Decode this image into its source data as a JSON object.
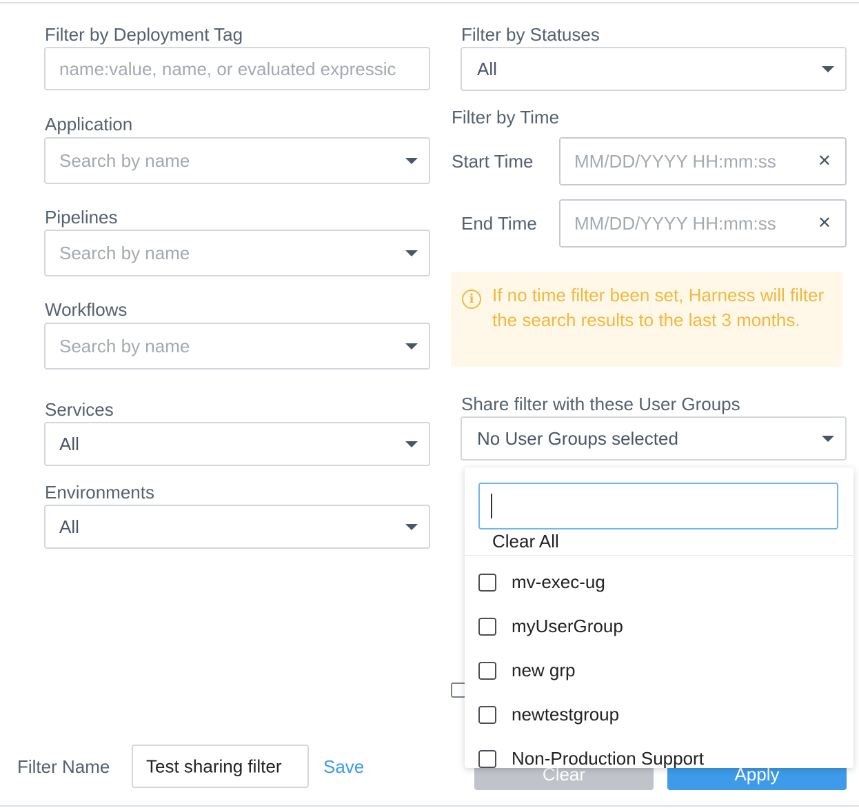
{
  "left": {
    "deployment_tag": {
      "label": "Filter by Deployment Tag",
      "placeholder": "name:value, name, or evaluated expressic"
    },
    "application": {
      "label": "Application",
      "placeholder": "Search by name"
    },
    "pipelines": {
      "label": "Pipelines",
      "placeholder": "Search by name"
    },
    "workflows": {
      "label": "Workflows",
      "placeholder": "Search by name"
    },
    "services": {
      "label": "Services",
      "value": "All"
    },
    "environments": {
      "label": "Environments",
      "value": "All"
    }
  },
  "right": {
    "statuses": {
      "label": "Filter by Statuses",
      "value": "All"
    },
    "time": {
      "label": "Filter by Time",
      "start_label": "Start Time",
      "end_label": "End Time",
      "placeholder": "MM/DD/YYYY HH:mm:ss",
      "clear_glyph": "✕"
    },
    "info": {
      "icon": "info-circle-icon",
      "icon_glyph": "i",
      "text": "If no time filter been set, Harness will filter the search results to the last 3 months.",
      "color": "#f0b93e"
    },
    "share": {
      "label": "Share filter with these User Groups",
      "value": "No User Groups selected"
    }
  },
  "dropdown": {
    "search_value": "",
    "clear_all": "Clear All",
    "options": [
      "mv-exec-ug",
      "myUserGroup",
      "new grp",
      "newtestgroup",
      "Non-Production Support"
    ]
  },
  "footer": {
    "filter_name_label": "Filter Name",
    "filter_name_value": "Test sharing filter",
    "save_label": "Save",
    "clear_label": "Clear",
    "apply_label": "Apply"
  },
  "colors": {
    "accent": "#3d9be9",
    "warning": "#f0b93e"
  }
}
